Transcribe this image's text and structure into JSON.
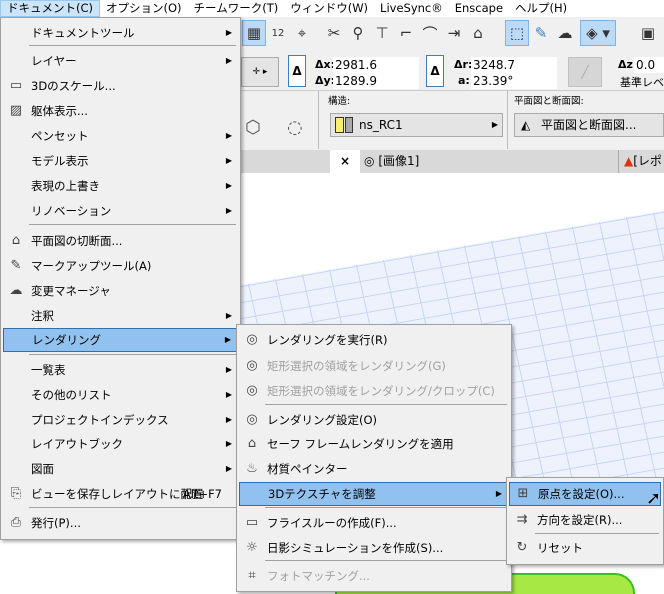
{
  "menubar": [
    "ドキュメント(C)",
    "オプション(O)",
    "チームワーク(T)",
    "ウィンドウ(W)",
    "LiveSync®",
    "Enscape",
    "ヘルプ(H)"
  ],
  "coords": {
    "dx_label": "Δx:",
    "dx": "2981.6",
    "dy_label": "Δy:",
    "dy": "1289.9",
    "dr_label": "Δr:",
    "dr": "3248.7",
    "a_label": "a:",
    "a": "23.39°",
    "dz_label": "Δz:",
    "dz": "0.0",
    "ref": "基準レベ"
  },
  "info": {
    "structure_label": "構造:",
    "structure_value": "ns_RC1",
    "plan_label": "平面図と断面図:",
    "plan_value": "平面図と断面図..."
  },
  "tabs": {
    "close": "×",
    "tab1": "[画像1]",
    "tab2": "[レポ"
  },
  "doc_menu": [
    {
      "label": "ドキュメントツール",
      "arrow": true
    },
    {
      "label": "レイヤー",
      "arrow": true
    },
    {
      "label": "3Dのスケール...",
      "icon": "scale-icon"
    },
    {
      "label": "躯体表示...",
      "icon": "hatch-icon"
    },
    {
      "label": "ペンセット",
      "arrow": true
    },
    {
      "label": "モデル表示",
      "arrow": true
    },
    {
      "label": "表現の上書き",
      "arrow": true
    },
    {
      "label": "リノベーション",
      "arrow": true
    },
    {
      "label": "平面図の切断面...",
      "icon": "cut-plane-icon"
    },
    {
      "label": "マークアップツール(A)",
      "icon": "markup-icon"
    },
    {
      "label": "変更マネージャ",
      "icon": "change-manager-icon"
    },
    {
      "label": "注釈",
      "arrow": true
    },
    {
      "label": "レンダリング",
      "arrow": true,
      "highlight": true
    },
    {
      "label": "一覧表",
      "arrow": true
    },
    {
      "label": "その他のリスト",
      "arrow": true
    },
    {
      "label": "プロジェクトインデックス",
      "arrow": true
    },
    {
      "label": "レイアウトブック",
      "arrow": true
    },
    {
      "label": "図面",
      "arrow": true
    },
    {
      "label": "ビューを保存しレイアウトに配置",
      "shortcut": "Alt+F7",
      "icon": "save-view-icon"
    },
    {
      "label": "発行(P)...",
      "icon": "publish-icon"
    }
  ],
  "render_menu": [
    {
      "label": "レンダリングを実行(R)",
      "icon": "camera-icon"
    },
    {
      "label": "矩形選択の領域をレンダリング(G)",
      "disabled": true,
      "icon": "camera-marquee-icon"
    },
    {
      "label": "矩形選択の領域をレンダリング/クロップ(C)",
      "disabled": true,
      "icon": "camera-crop-icon"
    },
    {
      "label": "レンダリング設定(O)",
      "icon": "render-settings-icon"
    },
    {
      "label": "セーフ フレームレンダリングを適用",
      "icon": "safe-frame-icon"
    },
    {
      "label": "材質ペインター",
      "icon": "material-painter-icon"
    },
    {
      "label": "3Dテクスチャを調整",
      "arrow": true,
      "highlight": true
    },
    {
      "label": "フライスルーの作成(F)...",
      "icon": "flythrough-icon"
    },
    {
      "label": "日影シミュレーションを作成(S)...",
      "icon": "sun-study-icon"
    },
    {
      "label": "フォトマッチング...",
      "disabled": true,
      "icon": "photo-match-icon"
    }
  ],
  "texture_menu": [
    {
      "label": "原点を設定(O)...",
      "highlight": true,
      "icon": "texture-origin-icon"
    },
    {
      "label": "方向を設定(R)...",
      "icon": "texture-direction-icon"
    },
    {
      "label": "リセット",
      "icon": "texture-reset-icon"
    }
  ],
  "colors": {
    "highlight": "#91c1ee",
    "accent": "#2f6fb0"
  }
}
